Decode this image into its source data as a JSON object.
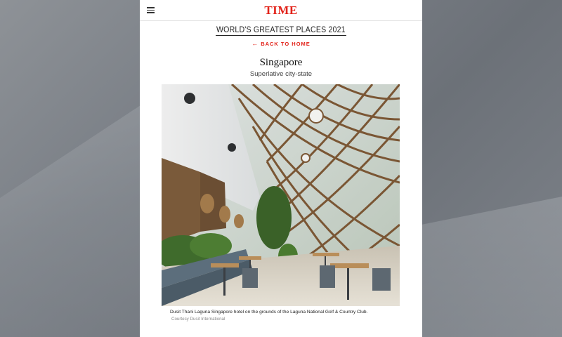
{
  "header": {
    "logo": "TIME",
    "menu_icon": "hamburger-menu-icon"
  },
  "section": {
    "title": "WORLD'S GREATEST PLACES 2021",
    "back_label": "BACK TO HOME",
    "back_icon": "arrow-left-icon"
  },
  "place": {
    "name": "Singapore",
    "subtitle": "Superlative city-state"
  },
  "photo": {
    "caption": "Dusit Thani Laguna Singapore hotel on the grounds of the Laguna National Golf & Country Club.",
    "credit": "Courtesy Dusit International"
  },
  "colors": {
    "brand_red": "#e2231a",
    "page_bg": "#ffffff",
    "backdrop": "#7b8087"
  }
}
